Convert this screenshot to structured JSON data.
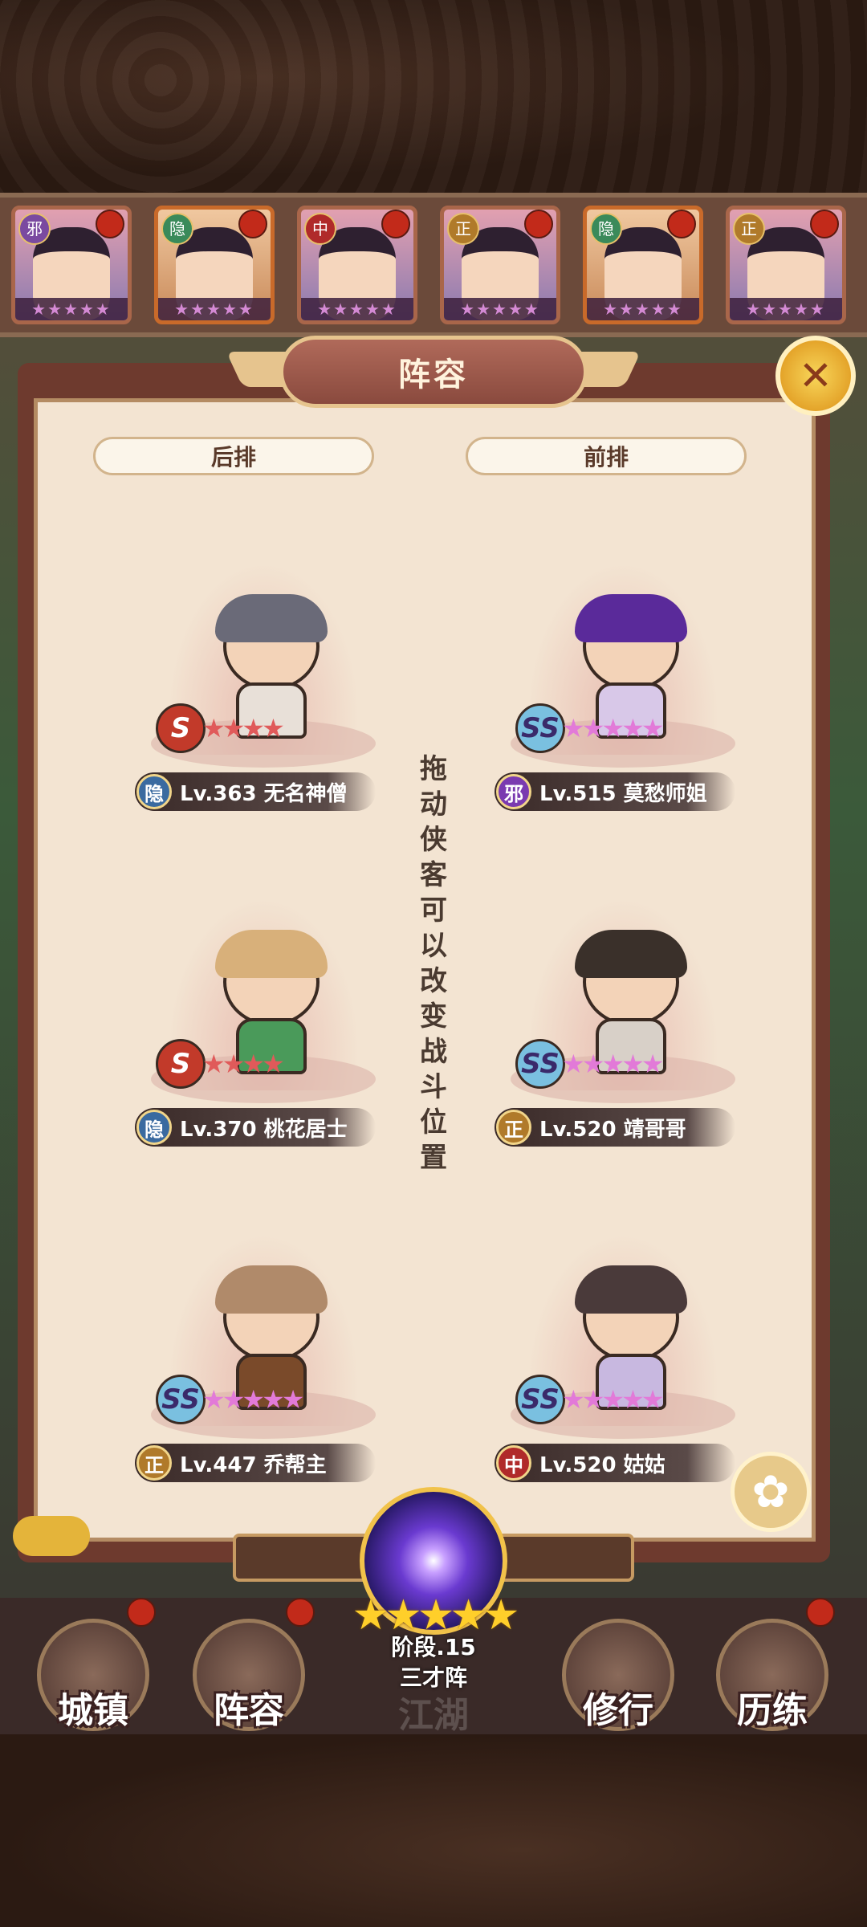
{
  "roster": [
    {
      "faction": "邪",
      "stars": "★★★★★",
      "selected": false
    },
    {
      "faction": "隐",
      "stars": "★★★★★",
      "selected": true
    },
    {
      "faction": "中",
      "stars": "★★★★★",
      "selected": false
    },
    {
      "faction": "正",
      "stars": "★★★★★",
      "selected": false
    },
    {
      "faction": "隐",
      "stars": "★★★★★",
      "selected": true
    },
    {
      "faction": "正",
      "stars": "★★★★★",
      "selected": false
    }
  ],
  "panel": {
    "title": "阵容",
    "close_icon": "close-icon",
    "back_row_label": "后排",
    "front_row_label": "前排",
    "hint": "拖动侠客可以改变战斗位置"
  },
  "heroes": [
    {
      "slot": "back-1",
      "rank": "S",
      "stars": "★★★★",
      "faction": "隐",
      "faction_color": "#3a6aa0",
      "level_name": "Lv.363 无名神僧"
    },
    {
      "slot": "front-1",
      "rank": "SS",
      "stars": "★★★★★",
      "faction": "邪",
      "faction_color": "#7a3ab0",
      "level_name": "Lv.515 莫愁师姐"
    },
    {
      "slot": "back-2",
      "rank": "S",
      "stars": "★★★★",
      "faction": "隐",
      "faction_color": "#3a6aa0",
      "level_name": "Lv.370 桃花居士"
    },
    {
      "slot": "front-2",
      "rank": "SS",
      "stars": "★★★★★",
      "faction": "正",
      "faction_color": "#b07a2a",
      "level_name": "Lv.520 靖哥哥"
    },
    {
      "slot": "back-3",
      "rank": "SS",
      "stars": "★★★★★",
      "faction": "正",
      "faction_color": "#b07a2a",
      "level_name": "Lv.447 乔帮主"
    },
    {
      "slot": "front-3",
      "rank": "SS",
      "stars": "★★★★★",
      "faction": "中",
      "faction_color": "#b02a2a",
      "level_name": "Lv.520 姑姑"
    }
  ],
  "formation": {
    "stars": "★★★★★",
    "stage": "阶段.15",
    "name": "三才阵"
  },
  "nav": {
    "items": [
      "城镇",
      "阵容",
      "江湖",
      "修行",
      "历练"
    ]
  },
  "colors": {
    "panel_bg": "#f3e4d2",
    "frame": "#6e3a2e",
    "pink_star": "#e27ad8",
    "red_star": "#e05a5a",
    "gold": "#f1c24a"
  }
}
